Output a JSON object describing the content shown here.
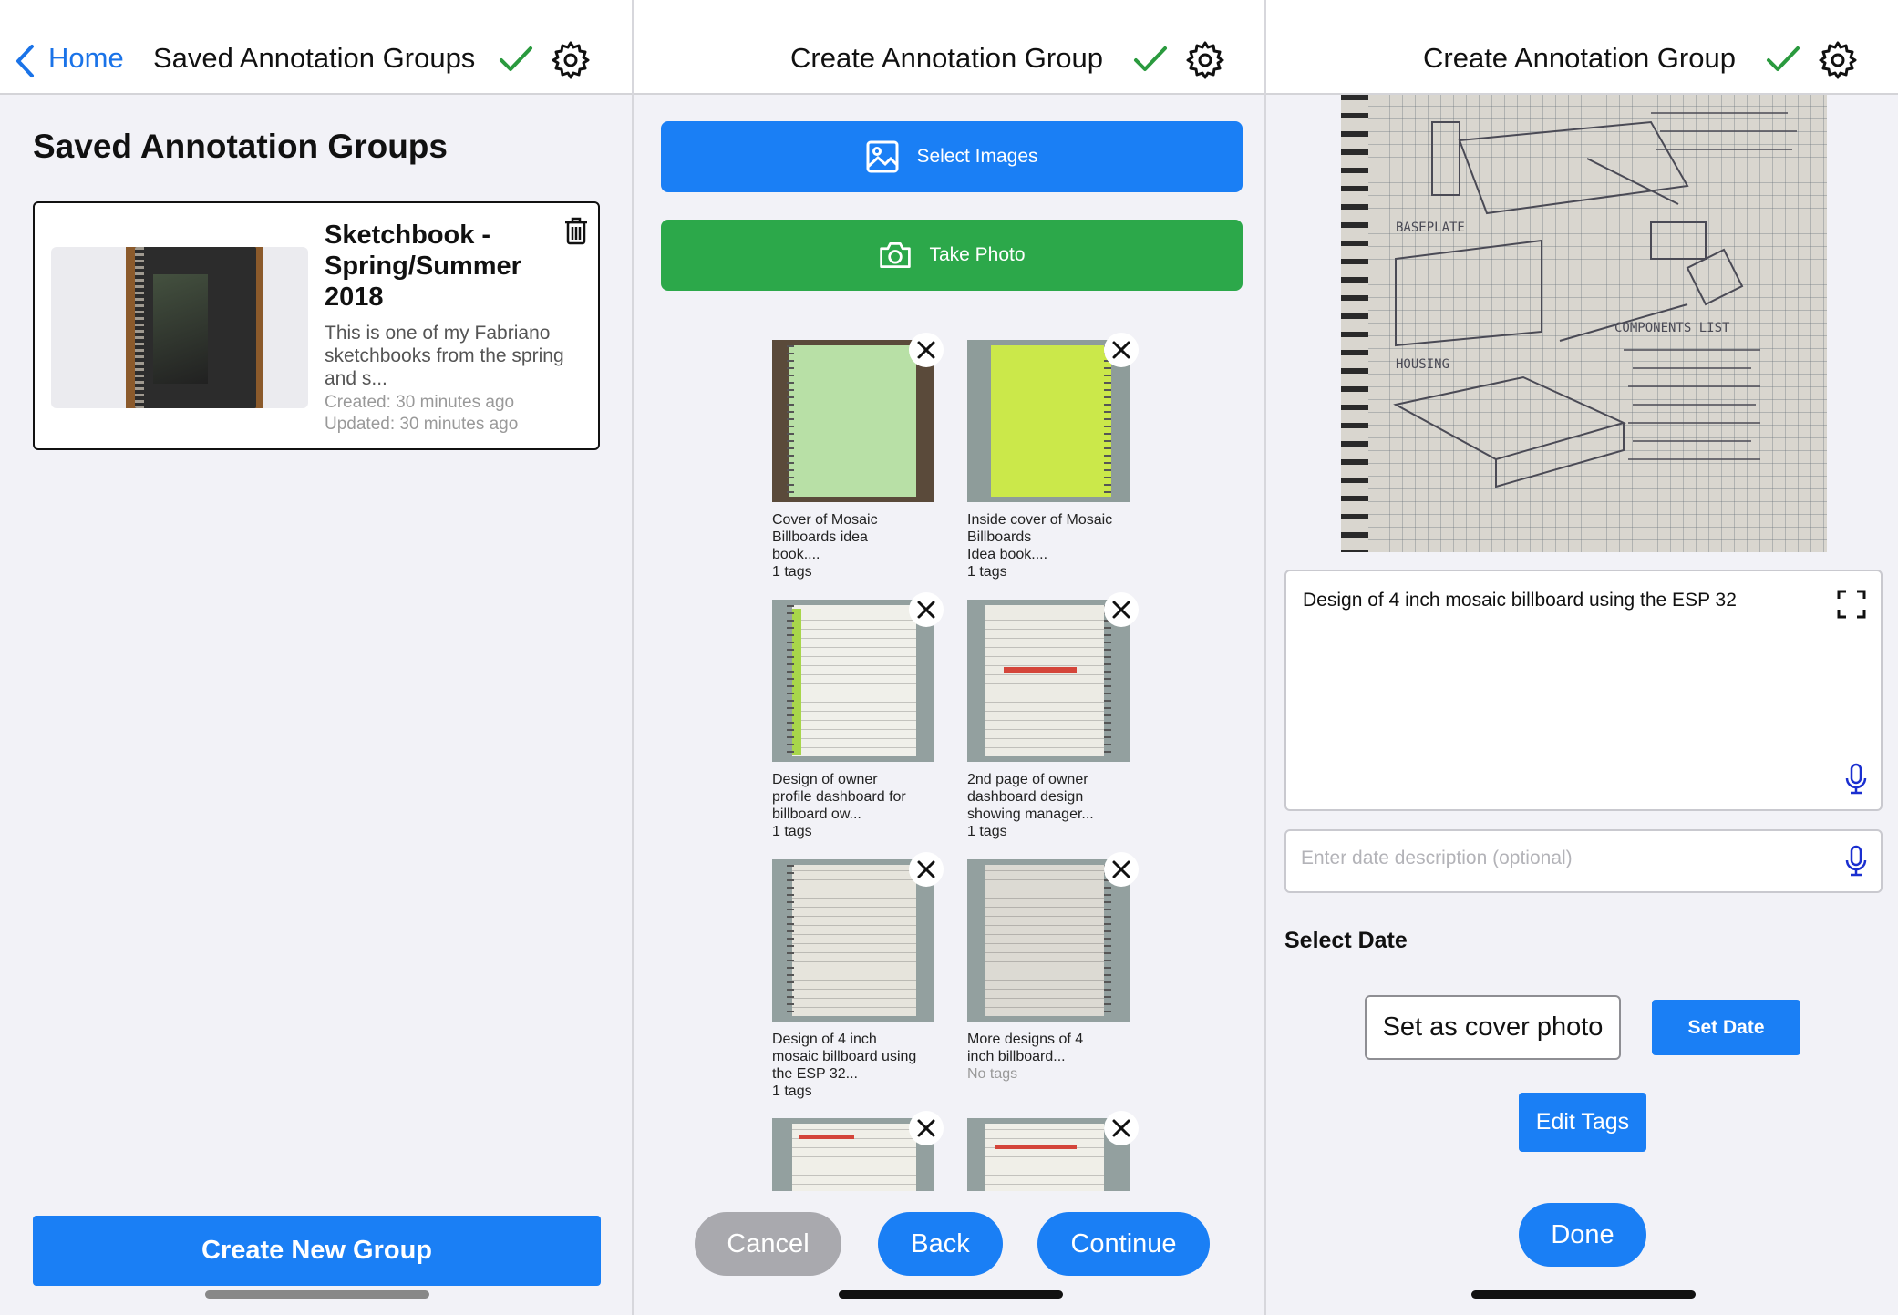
{
  "colors": {
    "accent": "#1a7ff5",
    "success": "#2ca84a",
    "cancel": "#a9a9ae",
    "check": "#2a9a3e"
  },
  "panel1": {
    "nav": {
      "back_label": "Home",
      "title": "Saved Annotation Groups"
    },
    "heading": "Saved Annotation Groups",
    "group": {
      "title": "Sketchbook - Spring/Summer 2018",
      "description": "This is one of my Fabriano sketchbooks from the spring and s...",
      "created": "Created: 30 minutes ago",
      "updated": "Updated: 30 minutes ago"
    },
    "create_button": "Create New Group"
  },
  "panel2": {
    "nav": {
      "title": "Create Annotation Group"
    },
    "select_images": "Select Images",
    "take_photo": "Take Photo",
    "images": [
      {
        "caption": "Cover of Mosaic\nBillboards idea\nbook....",
        "tags": "1 tags"
      },
      {
        "caption": "Inside cover of Mosaic\nBillboards\n Idea book....",
        "tags": "1 tags"
      },
      {
        "caption": "Design of owner\nprofile dashboard for\nbillboard ow...",
        "tags": "1 tags"
      },
      {
        "caption": "2nd page of owner\ndashboard design\nshowing manager...",
        "tags": "1 tags"
      },
      {
        "caption": "Design of 4 inch\nmosaic billboard using\nthe ESP 32...",
        "tags": "1 tags"
      },
      {
        "caption": "More designs of 4\ninch billboard...",
        "tags": "No tags"
      }
    ],
    "cancel": "Cancel",
    "back": "Back",
    "continue": "Continue"
  },
  "panel3": {
    "nav": {
      "title": "Create Annotation Group"
    },
    "description": "Design of 4 inch mosaic billboard using the ESP 32",
    "date_placeholder": "Enter date description (optional)",
    "select_date": "Select Date",
    "cover_photo": "Set as cover photo",
    "set_date": "Set Date",
    "edit_tags": "Edit Tags",
    "done": "Done"
  },
  "icons": [
    "chevron-left-icon",
    "checkmark-icon",
    "gear-icon",
    "trash-icon",
    "image-icon",
    "camera-icon",
    "close-icon",
    "expand-icon",
    "microphone-icon"
  ]
}
